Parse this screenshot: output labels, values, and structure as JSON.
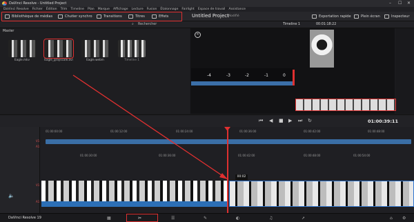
{
  "window": {
    "title": "DaVinci Resolve - Untitled Project"
  },
  "menu": [
    "DaVinci Resolve",
    "Fichier",
    "Édition",
    "Trim",
    "Timeline",
    "Plan",
    "Marque",
    "Affichage",
    "Lecture",
    "Fusion",
    "Étalonnage",
    "Fairlight",
    "Espace de travail",
    "Assistance"
  ],
  "toolbar": {
    "buttons": [
      "Bibliothèque de médias",
      "Chutier synchro",
      "Transitions",
      "Titres",
      "Effets"
    ],
    "project_title": "Untitled Project",
    "modified": "Modifié",
    "export": "Exportation rapide",
    "fullscreen": "Plein écran",
    "inspector": "Inspecteur"
  },
  "bar2": {
    "search": "Rechercher",
    "timeline": "Timeline 1",
    "timecode": "00:01:18:22"
  },
  "media_pool": {
    "folder": "Master",
    "clips": [
      {
        "name": "Eagle.mkv"
      },
      {
        "name": "Eagle_grayscale.avi"
      },
      {
        "name": "Eagle.webm"
      },
      {
        "name": "Timeline 1"
      }
    ]
  },
  "ruler_numbers": [
    "-4",
    "-3",
    "-2",
    "-1",
    "0"
  ],
  "transport": {
    "timecode": "01:00:39:11"
  },
  "timeline": {
    "ticks_top": [
      "01:00:00:00",
      "01:00:12:00",
      "01:00:24:00",
      "01:00:36:00",
      "01:00:42:00",
      "01:00:48:00"
    ],
    "ticks_bottom": [
      "01:00:30:00",
      "01:00:36:00",
      "01:00:42:00",
      "01:00:48:00",
      "01:00:54:00"
    ],
    "tooltip": "00:02",
    "tracks": [
      "V1",
      "A1",
      "V1",
      "A1"
    ]
  },
  "footer": {
    "app_name": "DaVinci Resolve 19"
  }
}
